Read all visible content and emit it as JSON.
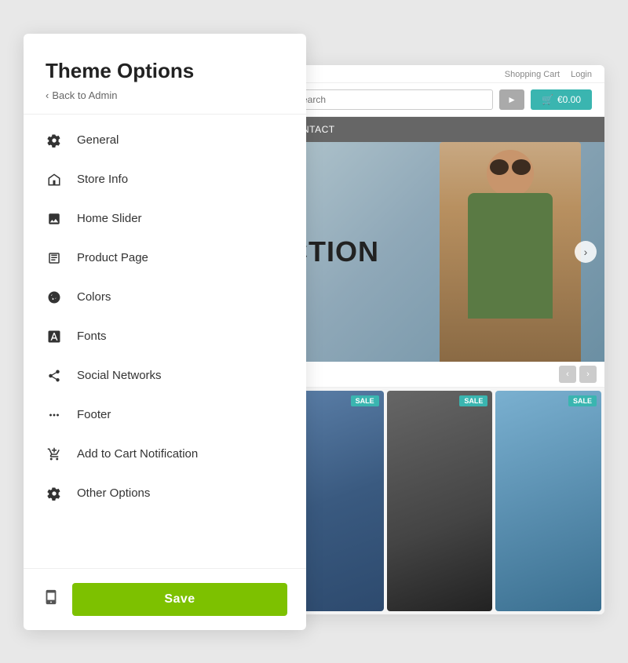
{
  "sidebar": {
    "title": "Theme Options",
    "back_label": "Back to Admin",
    "nav_items": [
      {
        "id": "general",
        "label": "General",
        "icon": "gear"
      },
      {
        "id": "store-info",
        "label": "Store Info",
        "icon": "store"
      },
      {
        "id": "home-slider",
        "label": "Home Slider",
        "icon": "image"
      },
      {
        "id": "product-page",
        "label": "Product Page",
        "icon": "product"
      },
      {
        "id": "colors",
        "label": "Colors",
        "icon": "drop"
      },
      {
        "id": "fonts",
        "label": "Fonts",
        "icon": "font"
      },
      {
        "id": "social-networks",
        "label": "Social Networks",
        "icon": "share"
      },
      {
        "id": "footer",
        "label": "Footer",
        "icon": "dots"
      },
      {
        "id": "add-to-cart",
        "label": "Add to Cart Notification",
        "icon": "cart"
      },
      {
        "id": "other-options",
        "label": "Other Options",
        "icon": "gear-alt"
      }
    ],
    "save_label": "Save"
  },
  "preview": {
    "topbar": {
      "shopping_cart": "Shopping Cart",
      "login": "Login"
    },
    "search_placeholder": "Search",
    "cart_label": "€0.00",
    "nav_text": "CONTACT",
    "hero_text": "CTION",
    "sale_badge": "SALE",
    "prev_btn": "‹",
    "next_btn": "›"
  }
}
